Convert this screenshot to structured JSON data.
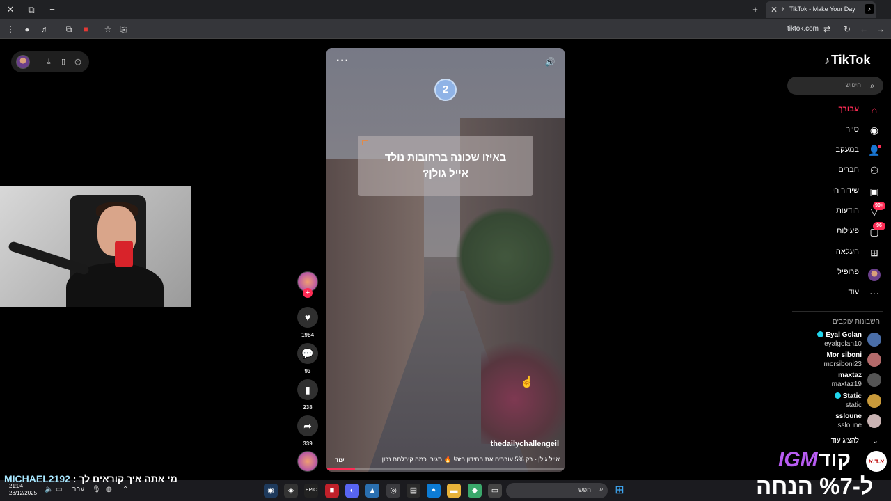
{
  "browser": {
    "tab_title": "TikTok - Make Your Day",
    "url": "tiktok.com"
  },
  "video": {
    "badge_number": "2",
    "question_line1": "באיזו שכונה ברחובות נולד",
    "question_line2": "אייל גולן?",
    "author": "thedailychallengeil",
    "caption": "אייל גולן - רק 5% עוברים את החידון הזה! 🔥 תגיבו כמה קיבלתם נכון",
    "more_label": "עוד",
    "progress": 0.12
  },
  "actions": {
    "likes": "1984",
    "comments": "93",
    "saves": "238",
    "shares": "339"
  },
  "sidebar": {
    "brand": "TikTok",
    "search_placeholder": "חיפוש",
    "nav": [
      {
        "label": "עבורך",
        "icon": "home-icon",
        "active": true
      },
      {
        "label": "סייר",
        "icon": "compass-icon",
        "active": false
      },
      {
        "label": "במעקב",
        "icon": "following-icon",
        "active": false
      },
      {
        "label": "חברים",
        "icon": "friends-icon",
        "active": false
      },
      {
        "label": "שידור חי",
        "icon": "live-icon",
        "active": false
      },
      {
        "label": "הודעות",
        "icon": "messages-icon",
        "badge": "99+",
        "active": false
      },
      {
        "label": "פעילות",
        "icon": "activity-icon",
        "badge": "96",
        "active": false
      },
      {
        "label": "העלאה",
        "icon": "upload-icon",
        "active": false
      },
      {
        "label": "פרופיל",
        "icon": "profile-icon",
        "active": false
      },
      {
        "label": "עוד",
        "icon": "more-icon",
        "active": false
      }
    ],
    "following_title": "חשבונות עוקבים",
    "accounts": [
      {
        "name": "Eyal Golan",
        "user": "eyalgolan10",
        "verified": true
      },
      {
        "name": "Mor siboni",
        "user": "morsiboni23",
        "verified": false
      },
      {
        "name": "maxtaz",
        "user": "maxtaz19",
        "verified": false
      },
      {
        "name": "Static",
        "user": "static",
        "verified": true
      },
      {
        "name": "ssloune",
        "user": "ssloune",
        "verified": false
      }
    ],
    "show_more": "להציג עוד"
  },
  "overlay": {
    "chat_user": "MICHAEL2192",
    "chat_text": " : מי אתה איך קוראים לך",
    "promo_igm": "IGM",
    "promo_kod": "קוד",
    "promo_logo": "א.ד.א",
    "promo_discount": "ל-%7 הנחה"
  },
  "taskbar": {
    "time": "21:04",
    "date": "28/12/2025",
    "lang": "עבר",
    "search_placeholder": "חפש"
  },
  "colors": {
    "accent": "#fe2c55",
    "verified": "#20d5ec",
    "promo_purple": "#b85cf2"
  }
}
